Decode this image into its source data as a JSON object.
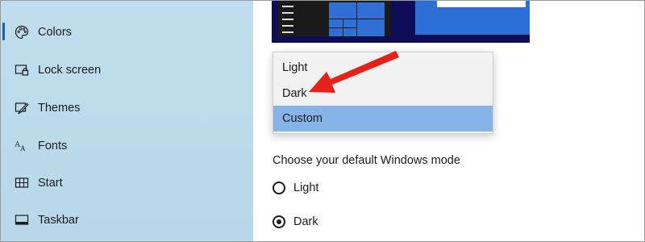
{
  "sidebar": {
    "items": [
      {
        "label": "Colors",
        "icon": "palette-icon",
        "selected": true
      },
      {
        "label": "Lock screen",
        "icon": "lock-screen-icon",
        "selected": false
      },
      {
        "label": "Themes",
        "icon": "themes-icon",
        "selected": false
      },
      {
        "label": "Fonts",
        "icon": "fonts-icon",
        "selected": false
      },
      {
        "label": "Start",
        "icon": "start-icon",
        "selected": false
      },
      {
        "label": "Taskbar",
        "icon": "taskbar-icon",
        "selected": false
      }
    ]
  },
  "dropdown": {
    "options": [
      "Light",
      "Dark",
      "Custom"
    ],
    "selected": "Custom"
  },
  "windows_mode": {
    "title": "Choose your default Windows mode",
    "options": [
      {
        "label": "Light",
        "checked": false
      },
      {
        "label": "Dark",
        "checked": true
      }
    ]
  },
  "colors": {
    "sidebar_bg": "#bcdcec",
    "accent": "#1a5fb4",
    "dropdown_selected": "#87b4e8",
    "annotation_arrow": "#e8201a",
    "preview_bg": "#0c0c57"
  }
}
